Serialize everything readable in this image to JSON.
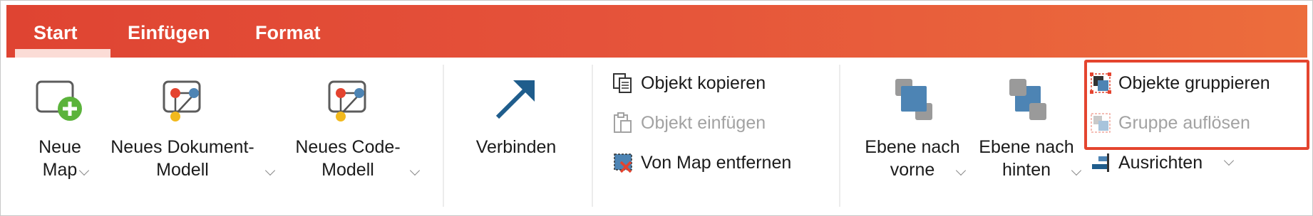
{
  "tabs": {
    "start": "Start",
    "einfuegen": "Einfügen",
    "format": "Format"
  },
  "groups": {
    "neue_map": {
      "line1": "Neue",
      "line2": "Map",
      "icon": "new-map-icon"
    },
    "neues_dokument_modell": {
      "line1": "Neues Dokument-",
      "line2": "Modell",
      "icon": "document-model-icon"
    },
    "neues_code_modell": {
      "line1": "Neues Code-",
      "line2": "Modell",
      "icon": "code-model-icon"
    },
    "verbinden": {
      "label": "Verbinden",
      "icon": "connect-arrow-icon"
    },
    "objekt_kopieren": {
      "label": "Objekt kopieren",
      "icon": "copy-icon"
    },
    "objekt_einfuegen": {
      "label": "Objekt einfügen",
      "icon": "paste-icon"
    },
    "von_map_entfernen": {
      "label": "Von Map entfernen",
      "icon": "remove-from-map-icon"
    },
    "ebene_nach_vorne": {
      "line1": "Ebene nach",
      "line2": "vorne",
      "icon": "bring-forward-icon"
    },
    "ebene_nach_hinten": {
      "line1": "Ebene nach",
      "line2": "hinten",
      "icon": "send-backward-icon"
    },
    "objekte_gruppieren": {
      "label": "Objekte gruppieren",
      "icon": "group-icon"
    },
    "gruppe_aufloesen": {
      "label": "Gruppe auflösen",
      "icon": "ungroup-icon"
    },
    "ausrichten": {
      "label": "Ausrichten",
      "icon": "align-icon"
    }
  },
  "colors": {
    "accent": "#e4452f",
    "tab_gradient_start": "#df4432",
    "tab_gradient_end": "#ec6d3c",
    "icon_blue": "#4d84b4",
    "disabled_text": "#a2a2a2"
  }
}
